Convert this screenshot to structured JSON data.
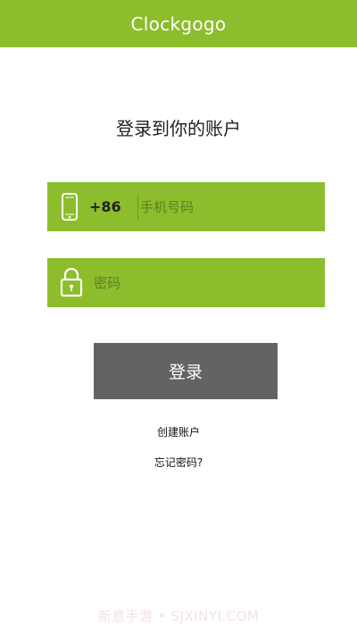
{
  "header": {
    "title": "Clockgogo"
  },
  "page": {
    "title": "登录到你的账户"
  },
  "phone_field": {
    "icon": "phone-icon",
    "country_code": "+86",
    "placeholder": "手机号码"
  },
  "password_field": {
    "icon": "lock-icon",
    "placeholder": "密码"
  },
  "login_button": {
    "label": "登录"
  },
  "links": {
    "create_account": "创建账户",
    "forgot_password": "忘记密码?"
  },
  "watermark": {
    "text": "新意手游 • SJXINYI.COM"
  },
  "colors": {
    "accent": "#8cbd2d",
    "button": "#636363"
  }
}
